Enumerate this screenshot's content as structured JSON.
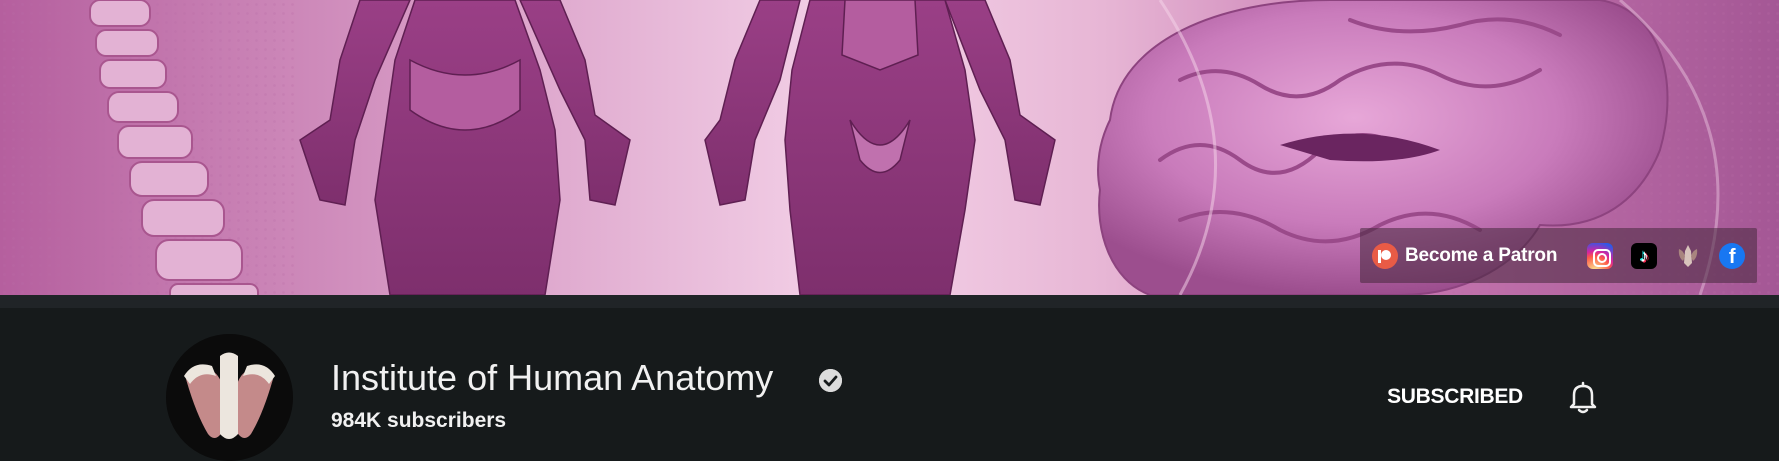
{
  "banner": {
    "links": {
      "patreon_label": "Become a Patron",
      "icons": [
        "patreon-icon",
        "instagram-icon",
        "tiktok-icon",
        "anatomy-logo-icon",
        "facebook-icon"
      ],
      "tiktok_glyph": "♪",
      "facebook_glyph": "f"
    },
    "colors": {
      "banner_base": "#c474ae",
      "banner_light": "#f4d2e8",
      "link_box": "#46283c"
    }
  },
  "channel": {
    "name": "Institute of Human Anatomy",
    "subscribers": "984K subscribers",
    "verified_icon": "verified-check-icon",
    "avatar_icon": "uterus-logo-icon"
  },
  "actions": {
    "subscribe_label": "SUBSCRIBED",
    "bell_icon": "notification-bell-icon"
  },
  "colors": {
    "page_background": "#161a1b",
    "text_primary": "#f1f1f1",
    "patreon": "#e85b46",
    "facebook": "#1877f2"
  }
}
